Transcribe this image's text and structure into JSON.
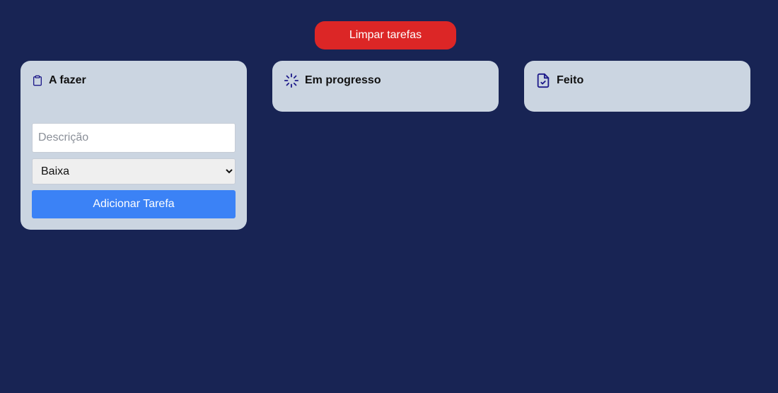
{
  "toolbar": {
    "clear_label": "Limpar tarefas",
    "clear_color": "#dc2626"
  },
  "columns": [
    {
      "title": "A fazer",
      "icon": "clipboard-icon"
    },
    {
      "title": "Em progresso",
      "icon": "loader-icon"
    },
    {
      "title": "Feito",
      "icon": "file-check-icon"
    }
  ],
  "form": {
    "description_placeholder": "Descrição",
    "description_value": "",
    "priority_selected": "Baixa",
    "add_label": "Adicionar Tarefa",
    "add_color": "#3b82f6"
  },
  "colors": {
    "background": "#182454",
    "column_bg": "#cbd5e1",
    "icon": "#1e1b8a"
  }
}
